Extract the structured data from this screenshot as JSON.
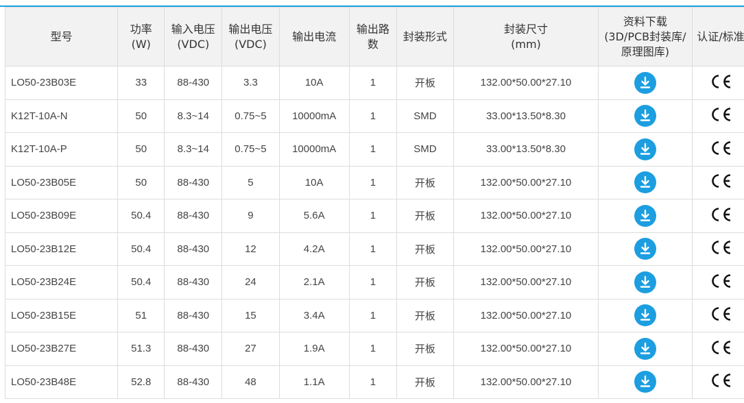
{
  "headers": {
    "model": "型号",
    "power": [
      "功率",
      "(W)"
    ],
    "vin": [
      "输入电压",
      "(VDC)"
    ],
    "vout": [
      "输出电压",
      "(VDC)"
    ],
    "iout": "输出电流",
    "channels": [
      "输出路",
      "数"
    ],
    "package": "封装形式",
    "size": [
      "封装尺寸",
      "(mm)"
    ],
    "download": [
      "资料下载",
      "(3D/PCB封装库/",
      "原理图库)"
    ],
    "cert": "认证/标准"
  },
  "rows": [
    {
      "model": "LO50-23B03E",
      "power": "33",
      "vin": "88-430",
      "vout": "3.3",
      "iout": "10A",
      "channels": "1",
      "package": "开板",
      "size": "132.00*50.00*27.10"
    },
    {
      "model": "K12T-10A-N",
      "power": "50",
      "vin": "8.3~14",
      "vout": "0.75~5",
      "iout": "10000mA",
      "channels": "1",
      "package": "SMD",
      "size": "33.00*13.50*8.30"
    },
    {
      "model": "K12T-10A-P",
      "power": "50",
      "vin": "8.3~14",
      "vout": "0.75~5",
      "iout": "10000mA",
      "channels": "1",
      "package": "SMD",
      "size": "33.00*13.50*8.30"
    },
    {
      "model": "LO50-23B05E",
      "power": "50",
      "vin": "88-430",
      "vout": "5",
      "iout": "10A",
      "channels": "1",
      "package": "开板",
      "size": "132.00*50.00*27.10"
    },
    {
      "model": "LO50-23B09E",
      "power": "50.4",
      "vin": "88-430",
      "vout": "9",
      "iout": "5.6A",
      "channels": "1",
      "package": "开板",
      "size": "132.00*50.00*27.10"
    },
    {
      "model": "LO50-23B12E",
      "power": "50.4",
      "vin": "88-430",
      "vout": "12",
      "iout": "4.2A",
      "channels": "1",
      "package": "开板",
      "size": "132.00*50.00*27.10"
    },
    {
      "model": "LO50-23B24E",
      "power": "50.4",
      "vin": "88-430",
      "vout": "24",
      "iout": "2.1A",
      "channels": "1",
      "package": "开板",
      "size": "132.00*50.00*27.10"
    },
    {
      "model": "LO50-23B15E",
      "power": "51",
      "vin": "88-430",
      "vout": "15",
      "iout": "3.4A",
      "channels": "1",
      "package": "开板",
      "size": "132.00*50.00*27.10"
    },
    {
      "model": "LO50-23B27E",
      "power": "51.3",
      "vin": "88-430",
      "vout": "27",
      "iout": "1.9A",
      "channels": "1",
      "package": "开板",
      "size": "132.00*50.00*27.10"
    },
    {
      "model": "LO50-23B48E",
      "power": "52.8",
      "vin": "88-430",
      "vout": "48",
      "iout": "1.1A",
      "channels": "1",
      "package": "开板",
      "size": "132.00*50.00*27.10"
    }
  ],
  "cert_mark": "CE",
  "icons": {
    "download": "download-circle-icon",
    "cert": "ce-mark-icon"
  },
  "colors": {
    "accent": "#1c9ee0",
    "header_bg": "#f2f2f2",
    "border": "#dcdcdc"
  }
}
